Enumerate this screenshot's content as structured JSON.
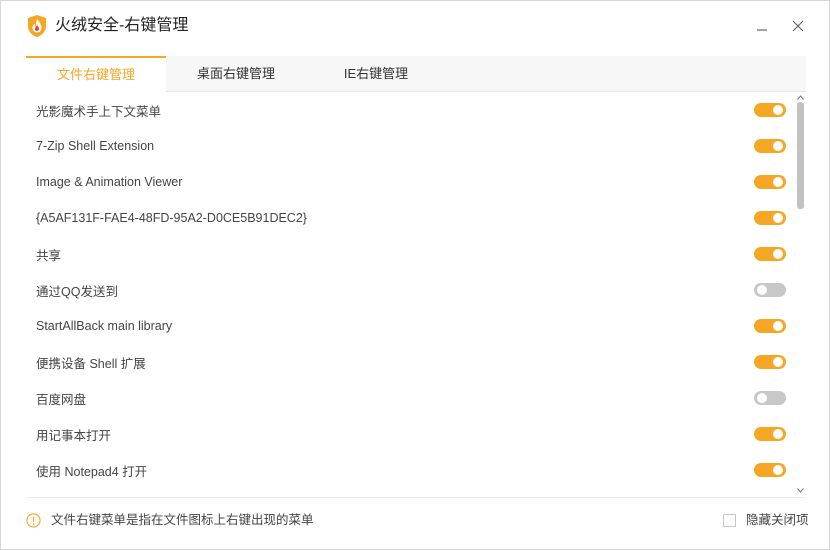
{
  "window": {
    "title": "火绒安全-右键管理",
    "minimize_icon": "minimize-icon",
    "close_icon": "close-icon",
    "logo_icon": "huorong-flame-shield-logo"
  },
  "colors": {
    "accent": "#f5a623",
    "toggle_off": "#c8c8c8",
    "tab_bar_bg": "#f7f7f7",
    "text": "#444444"
  },
  "tabs": [
    {
      "label": "文件右键管理",
      "active": true
    },
    {
      "label": "桌面右键管理",
      "active": false
    },
    {
      "label": "IE右键管理",
      "active": false
    }
  ],
  "items": [
    {
      "label": "光影魔术手上下文菜单",
      "enabled": true
    },
    {
      "label": "7-Zip Shell Extension",
      "enabled": true
    },
    {
      "label": "Image & Animation Viewer",
      "enabled": true
    },
    {
      "label": "{A5AF131F-FAE4-48FD-95A2-D0CE5B91DEC2}",
      "enabled": true
    },
    {
      "label": "共享",
      "enabled": true
    },
    {
      "label": "通过QQ发送到",
      "enabled": false
    },
    {
      "label": "StartAllBack main library",
      "enabled": true
    },
    {
      "label": "便携设备 Shell 扩展",
      "enabled": true
    },
    {
      "label": "百度网盘",
      "enabled": false
    },
    {
      "label": "用记事本打开",
      "enabled": true
    },
    {
      "label": "使用 Notepad4 打开",
      "enabled": true
    }
  ],
  "footer": {
    "info_icon": "info-circle-icon",
    "hint": "文件右键菜单是指在文件图标上右键出现的菜单",
    "hide_closed_label": "隐藏关闭项",
    "hide_closed_checked": false
  }
}
